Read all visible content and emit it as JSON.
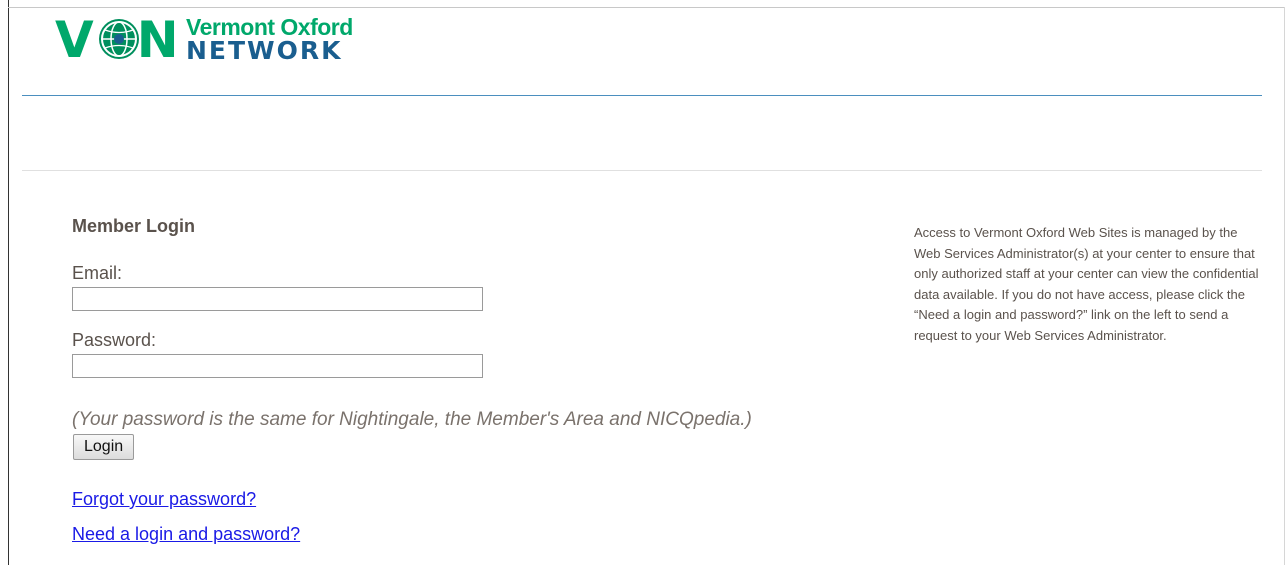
{
  "logo": {
    "von": "VON",
    "line1": "Vermont Oxford",
    "line2": "NETWORK"
  },
  "login": {
    "title": "Member Login",
    "email_label": "Email:",
    "email_value": "",
    "password_label": "Password:",
    "password_value": "",
    "note": "(Your password is the same for Nightingale, the Member's Area and NICQpedia.)",
    "login_button": "Login",
    "forgot_link": "Forgot your password?",
    "need_link": "Need a login and password?"
  },
  "info": {
    "text": "Access to Vermont Oxford Web Sites is managed by the Web Services Administrator(s) at your center to ensure that only authorized staff at your center can view the confidential data available. If you do not have access, please click the “Need a login and password?” link on the left to send a request to your Web Services Administrator."
  },
  "colors": {
    "brand_green": "#00a86b",
    "brand_blue": "#1a5e8f",
    "link": "#1a1ae6"
  }
}
